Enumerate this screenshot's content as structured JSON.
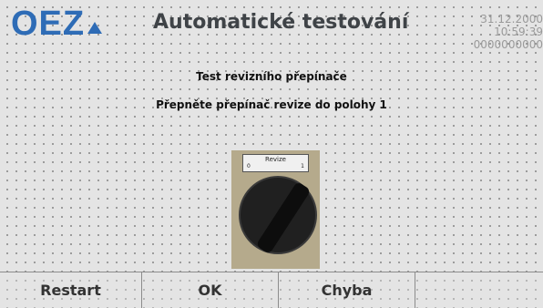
{
  "header": {
    "logo_text": "OEZ",
    "title": "Automatické testování",
    "date": "31.12.2000",
    "time": "10:59:39",
    "counter": "0000000000"
  },
  "main": {
    "heading": "Test revizního přepínače",
    "instruction": "Přepněte přepínač revize do polohy 1",
    "photo": {
      "plate_label": "Revize",
      "pos_0": "0",
      "pos_1": "1"
    }
  },
  "buttons": {
    "restart_label": "Restart",
    "ok_label": "OK",
    "error_label": "Chyba"
  },
  "colors": {
    "brand": "#2e6cb6",
    "title": "#3f4347",
    "background": "#e4e4e4"
  }
}
